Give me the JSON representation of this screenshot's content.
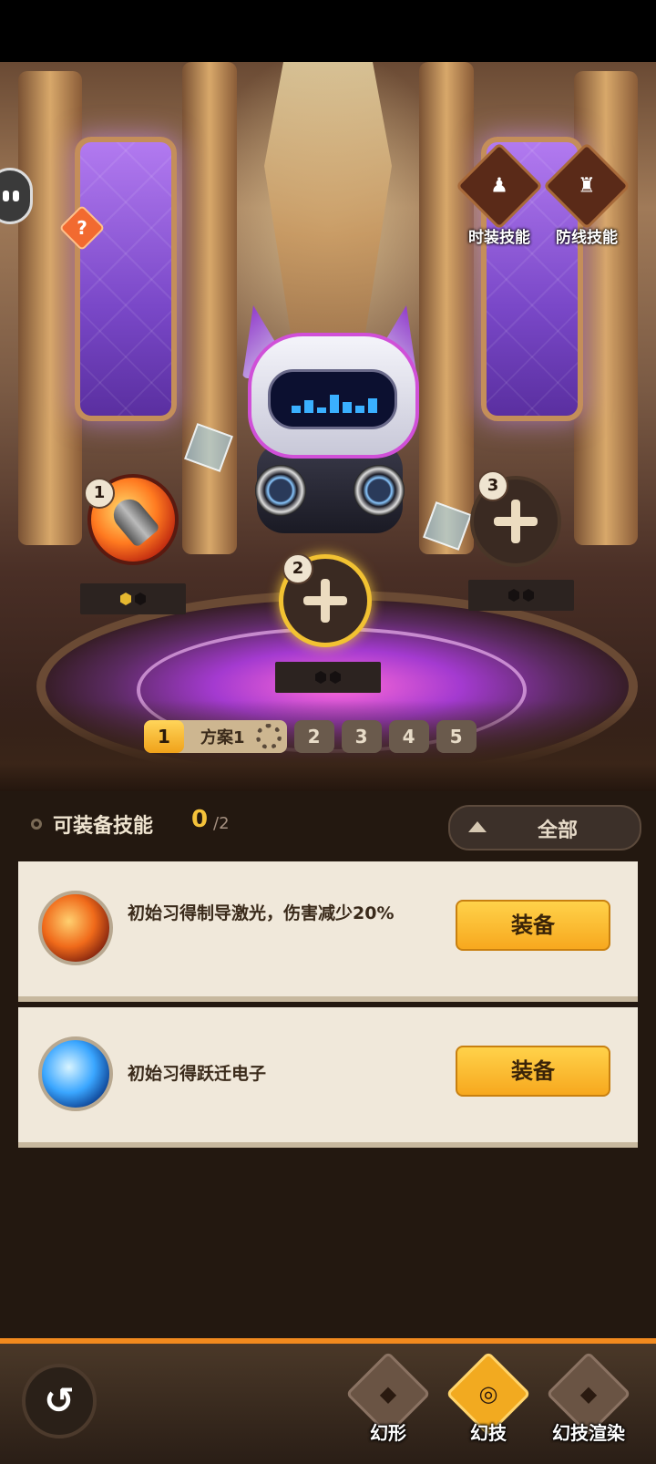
{
  "top_buttons": {
    "costume_skill": "时装技能",
    "defense_skill": "防线技能",
    "help": "?"
  },
  "slots": [
    {
      "number": "1",
      "filled": true,
      "skill_icon": "bullet-skill-icon",
      "gems": [
        "gold",
        "empty"
      ]
    },
    {
      "number": "2",
      "filled": false,
      "selected": true,
      "gems": [
        "empty",
        "empty"
      ]
    },
    {
      "number": "3",
      "filled": false,
      "gems": [
        "empty",
        "empty"
      ]
    }
  ],
  "schemes": {
    "active_number": "1",
    "active_name": "方案1",
    "tabs": [
      "2",
      "3",
      "4",
      "5"
    ]
  },
  "equippable": {
    "title": "可装备技能",
    "count": "0",
    "total": "/2",
    "filter_label": "全部"
  },
  "skills": [
    {
      "icon": "laser-skill-icon",
      "description": "初始习得制导激光，伤害减少20%",
      "button": "装备"
    },
    {
      "icon": "lightning-skill-icon",
      "description": "初始习得跃迁电子",
      "button": "装备"
    }
  ],
  "bottom_nav": [
    {
      "label": "幻形",
      "icon": "fox-head-icon",
      "active": false
    },
    {
      "label": "幻技",
      "icon": "swirl-icon",
      "active": true
    },
    {
      "label": "幻技渲染",
      "icon": "fox-brush-icon",
      "active": false
    }
  ],
  "colors": {
    "accent": "#f4c23a",
    "button": "#f7a81e",
    "panel": "#231810",
    "card": "#f0e8da"
  }
}
